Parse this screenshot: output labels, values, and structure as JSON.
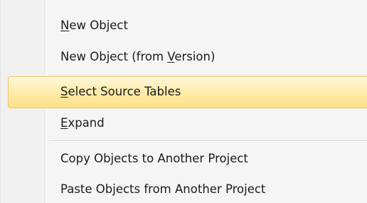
{
  "menu": {
    "items": [
      {
        "pre": "",
        "key": "N",
        "post": "ew Object"
      },
      {
        "pre": "New Object (from ",
        "key": "V",
        "post": "ersion)"
      },
      {
        "pre": "",
        "key": "S",
        "post": "elect Source Tables"
      },
      {
        "pre": "",
        "key": "E",
        "post": "xpand"
      },
      {
        "pre": "Copy Objects to Another Project",
        "key": "",
        "post": ""
      },
      {
        "pre": "Paste Objects from Another Project",
        "key": "",
        "post": ""
      }
    ],
    "highlighted_item": "Select Source Tables",
    "highlight_color": "#ffe8a0",
    "highlight_border_color": "#f0c168"
  }
}
